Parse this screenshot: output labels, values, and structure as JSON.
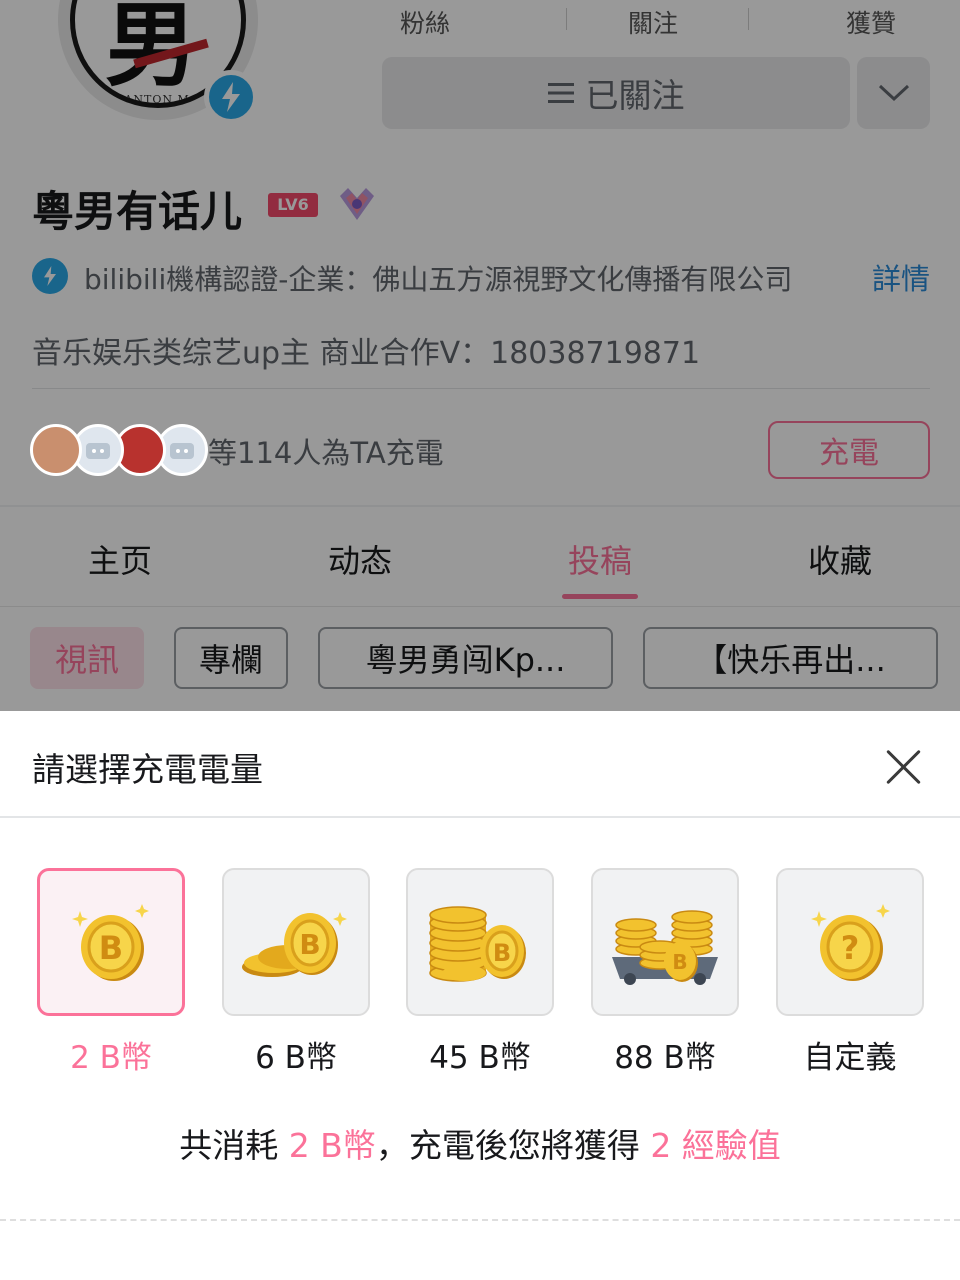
{
  "profile": {
    "avatar_text": "男",
    "avatar_brand": "CANTON MAN",
    "stats": {
      "fans_label": "粉絲",
      "following_label": "關注",
      "likes_label": "獲贊"
    },
    "follow_button": "已關注",
    "name": "粵男有话儿",
    "level": "LV6",
    "certification": "bilibili機構認證-企業：佛山五方源視野文化傳播有限公司",
    "certification_link": "詳情",
    "bio": "音乐娱乐类综艺up主  商业合作V：18038719871",
    "charge_count_text": "等114人為TA充電",
    "charge_button": "充電",
    "tabs": [
      {
        "label": "主页"
      },
      {
        "label": "动态"
      },
      {
        "label": "投稿",
        "active": true
      },
      {
        "label": "收藏"
      }
    ],
    "filters": [
      {
        "label": "視訊",
        "active": true
      },
      {
        "label": "專欄"
      },
      {
        "label": "粵男勇闯Kp..."
      },
      {
        "label": "【快乐再出..."
      }
    ]
  },
  "sheet": {
    "title": "請選擇充電電量",
    "options": [
      {
        "label": "2 B幣",
        "icon": "single-coin-icon",
        "selected": true
      },
      {
        "label": "6 B幣",
        "icon": "coin-pile-icon"
      },
      {
        "label": "45 B幣",
        "icon": "coin-stack-icon"
      },
      {
        "label": "88 B幣",
        "icon": "coin-cart-icon"
      },
      {
        "label": "自定義",
        "icon": "question-coin-icon"
      }
    ],
    "summary": {
      "prefix": "共消耗 ",
      "amount": "2 B幣",
      "middle": "，充電後您將獲得 ",
      "exp_amount": "2",
      "exp_unit": " 經驗值"
    }
  },
  "colors": {
    "accent": "#fb7299",
    "link": "#2a8ad8",
    "coin": "#f2c22e",
    "verify": "#2aa9e8"
  }
}
